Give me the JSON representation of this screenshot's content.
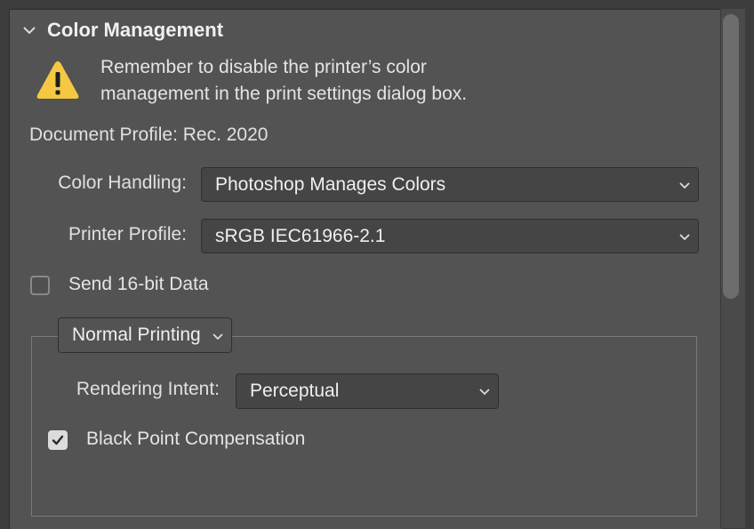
{
  "section": {
    "title": "Color Management",
    "expander_icon": "chevron-down-icon"
  },
  "warning": {
    "icon": "warning-icon",
    "line1": "Remember to disable the printer’s color",
    "line2": "management in the print settings dialog box."
  },
  "document_profile": "Document Profile: Rec. 2020",
  "color_handling": {
    "label": "Color Handling:",
    "value": "Photoshop Manages Colors"
  },
  "printer_profile": {
    "label": "Printer Profile:",
    "value": "sRGB IEC61966-2.1"
  },
  "send_16bit": {
    "label": "Send 16-bit Data",
    "checked": false
  },
  "printing_mode": {
    "value": "Normal Printing"
  },
  "rendering_intent": {
    "label": "Rendering Intent:",
    "value": "Perceptual"
  },
  "black_point": {
    "label": "Black Point Compensation",
    "checked": true
  },
  "colors": {
    "panel_bg": "#535353",
    "dropdown_bg": "#454545",
    "warning_yellow": "#f5c842",
    "text": "#e0e0e0"
  }
}
